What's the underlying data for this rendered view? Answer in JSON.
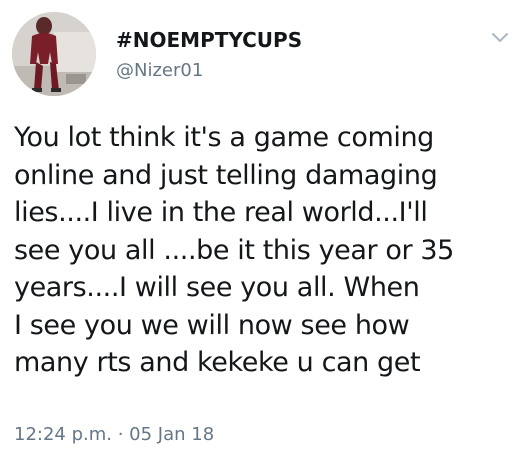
{
  "tweet": {
    "author": {
      "display_name": "#NOEMPTYCUPS",
      "handle": "@Nizer01"
    },
    "menu_icon": "chevron-down-icon",
    "text_lines": [
      "You lot think it's a game coming",
      "online and just telling damaging",
      "lies....I live in the real world...I'll",
      "see you all ....be it this year or 35",
      "years....I will see you all. When",
      "I see you we will now see how",
      "many rts and kekeke u can get"
    ],
    "timestamp": "12:24 p.m. · 05 Jan 18"
  },
  "colors": {
    "text_primary": "#14171a",
    "text_secondary": "#657786",
    "chevron": "#aab8c2",
    "background": "#ffffff"
  }
}
